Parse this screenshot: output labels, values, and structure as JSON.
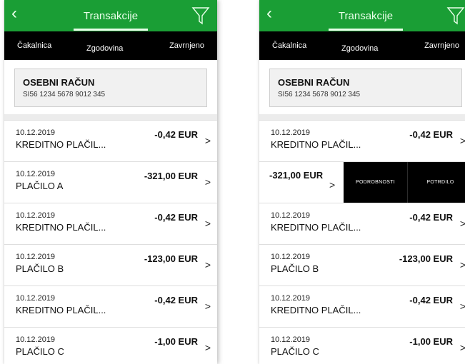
{
  "header": {
    "back_icon": "chevron-left-icon",
    "title": "Transakcije",
    "filter_icon": "filter-icon"
  },
  "tabs": [
    "Čakalnica",
    "Zgodovina",
    "Zavrnjeno"
  ],
  "account": {
    "name": "OSEBNI RAČUN",
    "iban": "SI56 1234 5678 9012 345"
  },
  "transactions": [
    {
      "date": "10.12.2019",
      "desc": "KREDITNO PLAČIL...",
      "amount": "-0,42 EUR"
    },
    {
      "date": "10.12.2019",
      "desc": "PLAČILO A",
      "amount": "-321,00 EUR"
    },
    {
      "date": "10.12.2019",
      "desc": "KREDITNO PLAČIL...",
      "amount": "-0,42 EUR"
    },
    {
      "date": "10.12.2019",
      "desc": "PLAČILO B",
      "amount": "-123,00 EUR"
    },
    {
      "date": "10.12.2019",
      "desc": "KREDITNO PLAČIL...",
      "amount": "-0,42 EUR"
    },
    {
      "date": "10.12.2019",
      "desc": "PLAČILO C",
      "amount": "-1,00 EUR"
    }
  ],
  "swipe_actions": {
    "details": "PODROBNOSTI",
    "confirm": "POTRDILO"
  },
  "chevron_glyph": ">",
  "colors": {
    "header_green": "#1a9e35",
    "tabs_black": "#000000"
  }
}
